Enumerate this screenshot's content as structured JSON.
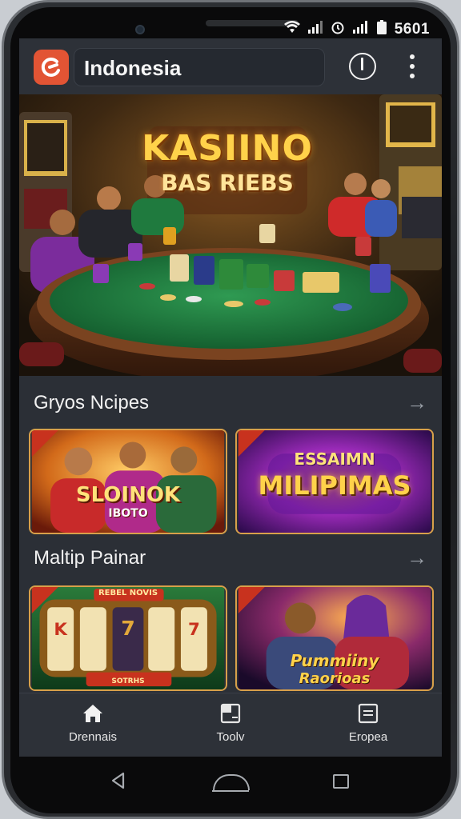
{
  "status_bar": {
    "wifi_icon": "wifi-icon",
    "signal_icon": "signal-icon",
    "alarm_icon": "alarm-icon",
    "battery_icon": "battery-icon",
    "time": "5601"
  },
  "app_bar": {
    "title": "Indonesia",
    "logo_icon": "app-logo-icon",
    "power_icon": "power-icon",
    "menu_icon": "more-vert-icon"
  },
  "hero": {
    "title": "KASIINO",
    "subtitle": "BAS RIEBS"
  },
  "sections": [
    {
      "title": "Gryos Ncipes",
      "arrow_icon": "arrow-right-icon",
      "cards": [
        {
          "title": "SLOINOK",
          "subtitle": "IBOTO"
        },
        {
          "title": "MILIPIMAS",
          "subtitle": "ESSAIMN"
        }
      ]
    },
    {
      "title": "Maltip Painar",
      "arrow_icon": "arrow-right-icon",
      "cards": [
        {
          "title": "REBEL NOVIS",
          "subtitle": "SOTRHS"
        },
        {
          "title": "Pummiiny",
          "subtitle": "Raorioas"
        }
      ]
    }
  ],
  "bottom_nav": [
    {
      "label": "Drennais",
      "icon": "home-icon"
    },
    {
      "label": "Toolv",
      "icon": "tool-icon"
    },
    {
      "label": "Eropea",
      "icon": "document-icon"
    }
  ],
  "system_nav": {
    "back_icon": "back-icon",
    "home_icon": "home-button-icon",
    "recents_icon": "recents-icon"
  },
  "colors": {
    "accent": "#e25434",
    "surface": "#2b2f36",
    "table_green": "#1f7a3e",
    "gold": "#ffd24a"
  }
}
